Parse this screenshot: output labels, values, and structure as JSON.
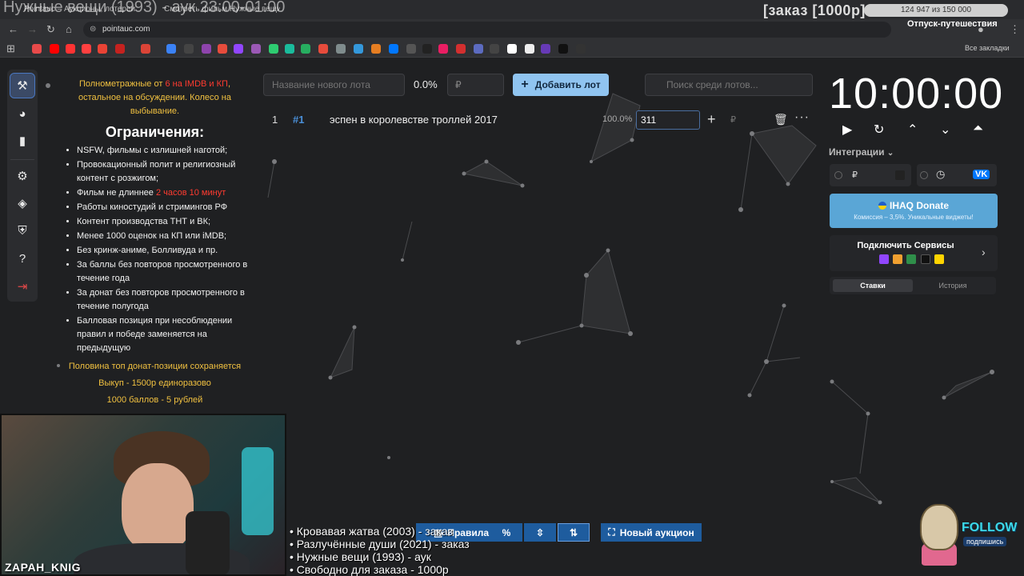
{
  "browser": {
    "tabs": [
      {
        "label": "Pointauc – Аукционы, лотереи"
      },
      {
        "label": "Смотреть фильм Нужные вещи"
      }
    ],
    "url": "pointauc.com",
    "bookmarks_all": "Все закладки"
  },
  "overlay": {
    "title": "Нужные вещи (1993) - аук 23:00-01:00",
    "order": "[заказ [1000р]",
    "progress_text": "124 947 из 150 000",
    "vacation": "Отпуск-путешествия"
  },
  "rules": {
    "intro_a": "Полнометражные от ",
    "intro_red": "6 на IMDB и КП",
    "intro_b": ", остальное на обсуждении. Колесо на выбывание.",
    "heading": "Ограничения:",
    "items": [
      "NSFW, фильмы с излишней наготой;",
      "Провокационный полит и религиозный контент с розжигом;",
      "Фильм не длиннее ",
      "Работы киностудий и стримингов РФ",
      "Контент производства ТНТ и ВК;",
      "Менее 1000 оценок на КП или iMDB;",
      "Без кринж-аниме, Болливуда и пр.",
      "За баллы без повторов просмотренного в течение года",
      "За донат без повторов просмотренного в течение полугода",
      "Балловая позиция при несоблюдении правил и победе заменяется на предыдущую"
    ],
    "duration_red": "2 часов 10 минут",
    "footer": [
      "Половина топ донат-позиции сохраняется",
      "Выкуп - 1500р единоразово",
      "1000 баллов - 5 рублей"
    ]
  },
  "controls": {
    "new_lot_placeholder": "Название нового лота",
    "percent": "0.0%",
    "sum_placeholder": "₽",
    "add_lot": "Добавить лот",
    "search_placeholder": "Поиск среди лотов..."
  },
  "lots": [
    {
      "num": "1",
      "id": "#1",
      "name": "эспен в королевстве троллей 2017",
      "percent": "100.0%",
      "amount": "311",
      "currency": "₽"
    }
  ],
  "timer": {
    "value": "10:00:00",
    "integrations": "Интеграции",
    "int_currency": "₽",
    "vk": "VK"
  },
  "donate": {
    "title": "IHAQ Donate",
    "subtitle": "Комиссия – 3,5%. Уникальные виджеты!"
  },
  "services": {
    "title": "Подключить Сервисы"
  },
  "history_tabs": {
    "bids": "Ставки",
    "history": "История"
  },
  "bottom": {
    "rules_btn": "Правила",
    "new_auction": "Новый аукцион",
    "percent_icon": "%"
  },
  "queue": [
    "• Кровавая жатва (2003) - заказ",
    "• Разлучённые души (2021) - заказ",
    "• Нужные вещи (1993) - аук",
    "• Свободно для заказа - 1000р"
  ],
  "cam": {
    "nick": "ZAPAH_KNIG"
  },
  "follow": {
    "label": "FOLLOW",
    "sub": "подпишись"
  },
  "colors": {
    "accent": "#90c4f0",
    "donate": "#5aa6d6",
    "rule_yellow": "#f0c040",
    "rule_red": "#ff3b30",
    "bottom_btn": "#1e5c9e"
  }
}
